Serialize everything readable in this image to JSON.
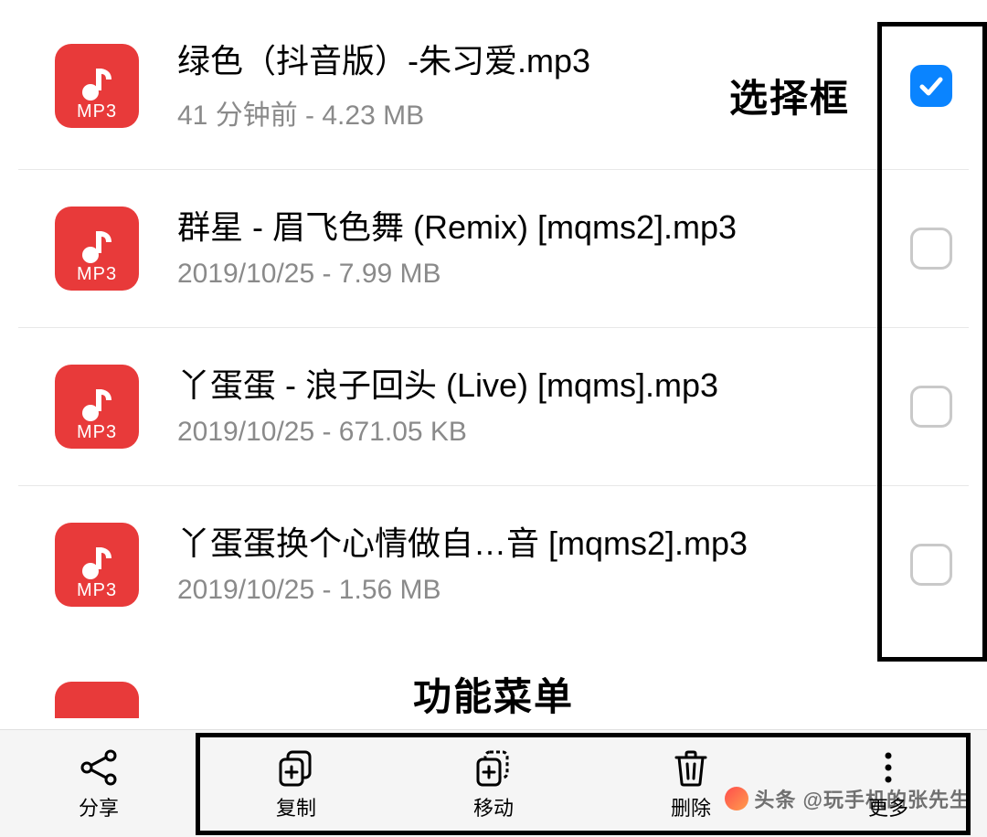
{
  "icon": {
    "ext_label": "MP3"
  },
  "files": [
    {
      "title": "绿色（抖音版）-朱习爱.mp3",
      "meta": "41 分钟前 - 4.23 MB",
      "checked": true
    },
    {
      "title": "群星 - 眉飞色舞 (Remix) [mqms2].mp3",
      "meta": "2019/10/25 - 7.99 MB",
      "checked": false
    },
    {
      "title": "丫蛋蛋 - 浪子回头 (Live) [mqms].mp3",
      "meta": "2019/10/25 - 671.05 KB",
      "checked": false
    },
    {
      "title": "丫蛋蛋换个心情做自…音 [mqms2].mp3",
      "meta": "2019/10/25 - 1.56 MB",
      "checked": false
    }
  ],
  "toolbar": {
    "share": "分享",
    "copy": "复制",
    "move": "移动",
    "delete": "删除",
    "more": "更多"
  },
  "annotations": {
    "select_box_label": "选择框",
    "function_menu_label": "功能菜单"
  },
  "watermark": "头条 @玩手机的张先生"
}
